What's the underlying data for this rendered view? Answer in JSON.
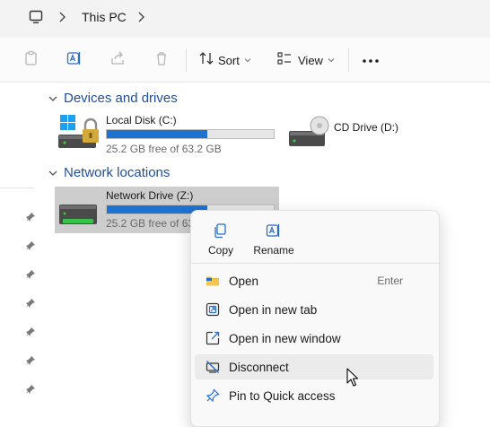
{
  "address_bar": {
    "location": "This PC"
  },
  "toolbar": {
    "sort_label": "Sort",
    "view_label": "View"
  },
  "groups": {
    "devices": {
      "title": "Devices and drives",
      "drives": [
        {
          "name": "Local Disk (C:)",
          "free_text": "25.2 GB free of 63.2 GB",
          "used_fraction": 0.6
        },
        {
          "name": "CD Drive (D:)"
        }
      ]
    },
    "network": {
      "title": "Network locations",
      "drives": [
        {
          "name": "Network Drive (Z:)",
          "free_text": "25.2 GB free of 63.2 GB",
          "used_fraction": 0.6
        }
      ]
    }
  },
  "context_menu": {
    "top_actions": [
      {
        "label": "Copy",
        "icon": "copy-icon"
      },
      {
        "label": "Rename",
        "icon": "rename-icon"
      }
    ],
    "items": [
      {
        "label": "Open",
        "shortcut": "Enter",
        "icon": "folder-icon"
      },
      {
        "label": "Open in new tab",
        "icon": "new-tab-icon"
      },
      {
        "label": "Open in new window",
        "icon": "new-window-icon"
      },
      {
        "label": "Disconnect",
        "icon": "disconnect-icon",
        "hovered": true
      },
      {
        "label": "Pin to Quick access",
        "icon": "pin-icon"
      }
    ]
  },
  "colors": {
    "accent": "#1e72d0",
    "header_blue": "#1f4e9c",
    "selection": "#cdcdcd"
  }
}
